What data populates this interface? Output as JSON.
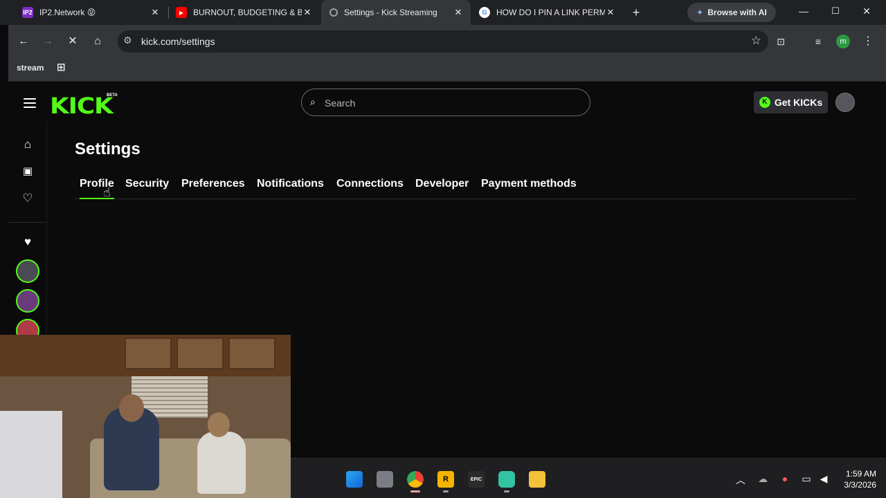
{
  "browser": {
    "tabs": [
      {
        "title": "IP2.Network 😝",
        "favicon_text": "IP2",
        "favicon_color": "#7b2fbe"
      },
      {
        "title": "BURNOUT, BUDGETING & B",
        "favicon_text": "▶",
        "favicon_color": "#ff0000"
      },
      {
        "title": "Settings - Kick Streaming",
        "favicon_text": "",
        "favicon_color": "#5f6368"
      },
      {
        "title": "HOW DO I PIN A LINK PERM",
        "favicon_text": "G",
        "favicon_color": "#4285f4"
      }
    ],
    "browse_with_ai": "Browse with AI",
    "url": "kick.com/settings",
    "profile_initial": "m",
    "bookmarks": {
      "stream": "stream"
    }
  },
  "kick": {
    "logo": "KICK",
    "logo_badge": "BETA",
    "search_placeholder": "Search",
    "get_kicks": "Get KICKs",
    "accent": "#53fc18",
    "settings_title": "Settings",
    "tabs": [
      "Profile",
      "Security",
      "Preferences",
      "Notifications",
      "Connections",
      "Developer",
      "Payment methods"
    ],
    "active_tab": "Profile"
  },
  "taskbar": {
    "apps": [
      "windows-start",
      "task-view",
      "chrome",
      "rockstar",
      "epic-games",
      "streamlabs",
      "file-explorer"
    ],
    "time": "1:59 AM",
    "date": "3/3/2026"
  }
}
